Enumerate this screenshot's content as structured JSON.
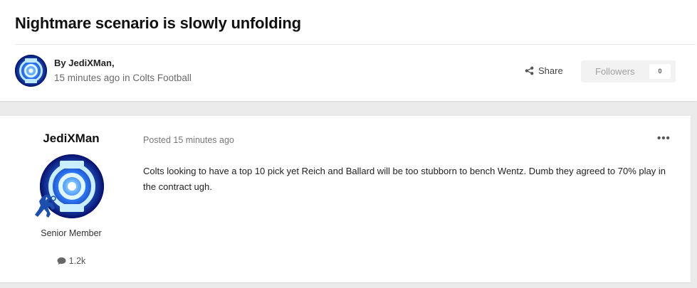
{
  "topic": {
    "title": "Nightmare scenario is slowly unfolding",
    "by_prefix": "By",
    "author": "JediXMan",
    "byline_suffix": ",",
    "time_ago": "15 minutes ago",
    "in_word": "in",
    "forum": "Colts Football"
  },
  "actions": {
    "share_label": "Share",
    "followers_label": "Followers",
    "followers_count": "0"
  },
  "post": {
    "author": "JediXMan",
    "member_title": "Senior Member",
    "post_count": "1.2k",
    "posted": "Posted 15 minutes ago",
    "menu": "•••",
    "body": "Colts looking to have a top 10 pick yet Reich and Ballard will be too stubborn to bench Wentz. Dumb they agreed to 70% play in the contract ugh."
  },
  "colors": {
    "page_bg": "#ebebeb",
    "avatar_blue": "#0b1d8c",
    "avatar_glow": "#3fa9ff"
  },
  "icons": [
    "share-icon",
    "comment-icon",
    "ellipsis-icon",
    "blue-lantern-avatar",
    "colts-rank-badge"
  ]
}
